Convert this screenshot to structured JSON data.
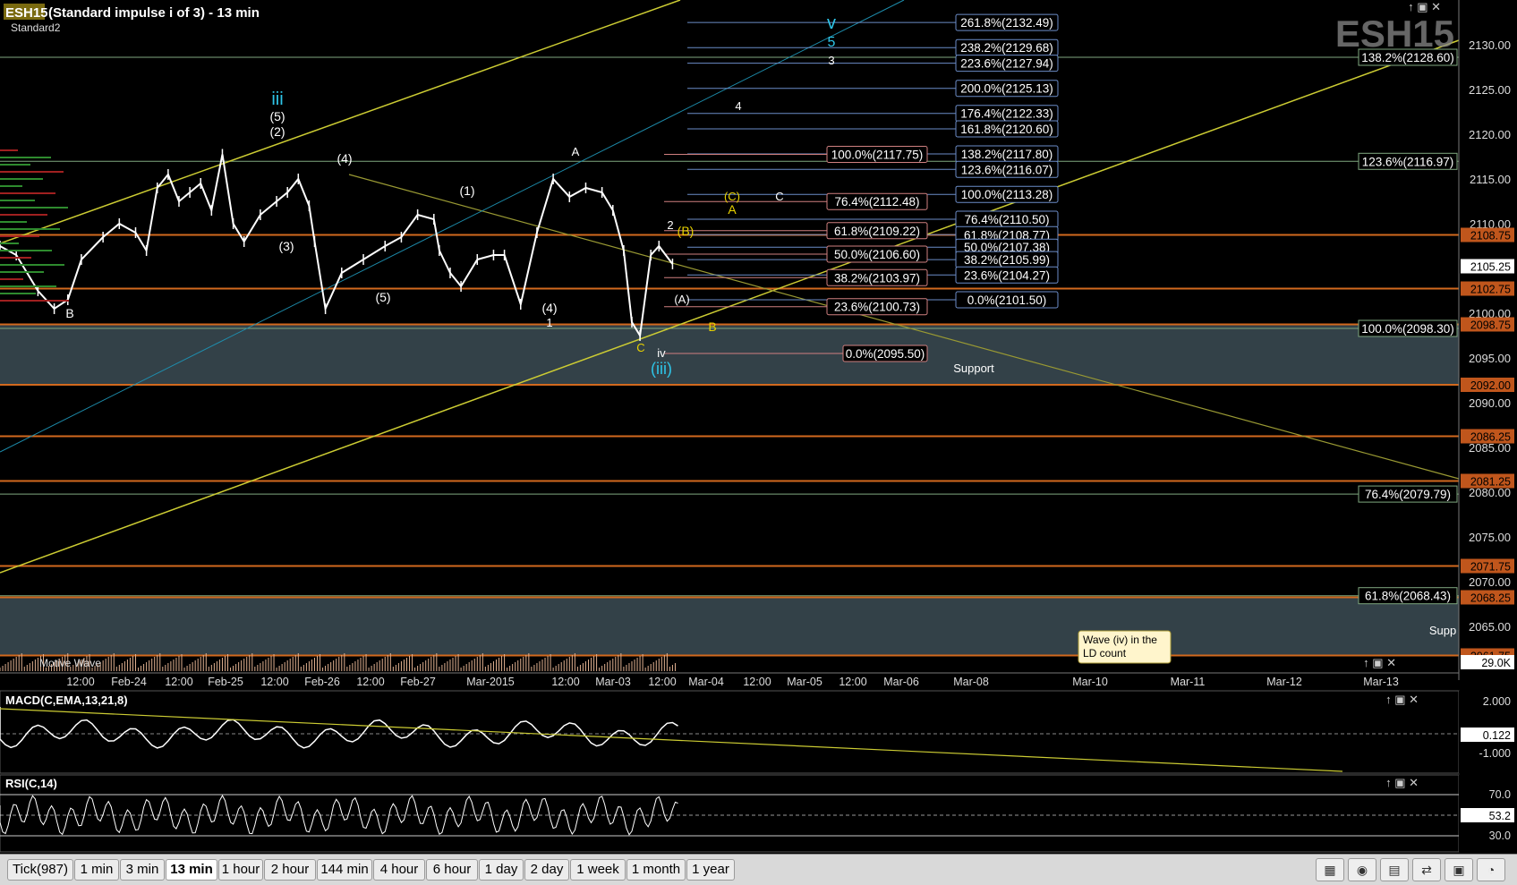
{
  "header": {
    "symbol": "ESH15",
    "title_rest": "(Standard impulse i of 3) - 13 min",
    "template": "Standard2",
    "watermark": "ESH15"
  },
  "chart_data": {
    "type": "candlestick",
    "symbol": "ESH15",
    "interval": "13 min",
    "price_axis": {
      "range": [
        2059,
        2135
      ],
      "ticks": [
        2130,
        2125,
        2120,
        2115,
        2110,
        2105,
        2100,
        2095,
        2090,
        2085,
        2080,
        2075,
        2070,
        2065
      ],
      "labels": [
        "2130.00",
        "2125.00",
        "2120.00",
        "2115.00",
        "2110.00",
        "2105.00",
        "2100.00",
        "2095.00",
        "2090.00",
        "2085.00",
        "2080.00",
        "2075.00",
        "2070.00",
        "2065.00"
      ],
      "current_price": "2105.25",
      "volume_label": "29.0K"
    },
    "x_axis_labels": [
      "12:00",
      "Feb-24",
      "12:00",
      "Feb-25",
      "12:00",
      "Feb-26",
      "12:00",
      "Feb-27",
      "Mar-2015",
      "12:00",
      "Mar-03",
      "12:00",
      "Mar-04",
      "12:00",
      "Mar-05",
      "12:00",
      "Mar-06",
      "Mar-08",
      "Mar-10",
      "Mar-11",
      "Mar-12",
      "Mar-13"
    ],
    "price_path": [
      [
        0,
        2107.5
      ],
      [
        6,
        2106.5
      ],
      [
        14,
        2102.5
      ],
      [
        20,
        2100.5
      ],
      [
        25,
        2101.5
      ],
      [
        30,
        2106
      ],
      [
        38,
        2108.5
      ],
      [
        44,
        2110
      ],
      [
        50,
        2109
      ],
      [
        54,
        2107
      ],
      [
        58,
        2114
      ],
      [
        62,
        2115.5
      ],
      [
        66,
        2112.5
      ],
      [
        70,
        2113.5
      ],
      [
        74,
        2114.5
      ],
      [
        78,
        2111.5
      ],
      [
        82,
        2117.75
      ],
      [
        86,
        2110
      ],
      [
        90,
        2108
      ],
      [
        96,
        2111
      ],
      [
        102,
        2112.5
      ],
      [
        106,
        2113.5
      ],
      [
        110,
        2115
      ],
      [
        114,
        2112
      ],
      [
        116,
        2108
      ],
      [
        120,
        2100.5
      ],
      [
        126,
        2104.5
      ],
      [
        134,
        2106
      ],
      [
        142,
        2107.5
      ],
      [
        148,
        2108.5
      ],
      [
        154,
        2111
      ],
      [
        160,
        2110.5
      ],
      [
        162,
        2107
      ],
      [
        166,
        2104.5
      ],
      [
        170,
        2103
      ],
      [
        176,
        2106
      ],
      [
        182,
        2106.5
      ],
      [
        186,
        2106.5
      ],
      [
        192,
        2101
      ],
      [
        198,
        2109
      ],
      [
        204,
        2115
      ],
      [
        210,
        2113
      ],
      [
        216,
        2114
      ],
      [
        222,
        2113.5
      ],
      [
        226,
        2111.5
      ],
      [
        230,
        2107
      ],
      [
        233,
        2099
      ],
      [
        236,
        2097.5
      ],
      [
        240,
        2106.5
      ],
      [
        243,
        2107.5
      ],
      [
        248,
        2105.5
      ]
    ],
    "horizontal_levels": [
      2108.75,
      2102.75,
      2098.75,
      2092.0,
      2086.25,
      2081.25,
      2071.75,
      2068.25,
      2061.75
    ],
    "right_axis_level_labels": [
      "2108.75",
      "2102.75",
      "2098.75",
      "2092.00",
      "2086.25",
      "2081.25",
      "2071.75",
      "2068.25",
      "2061.75"
    ],
    "support_zones": [
      [
        2092.0,
        2098.75
      ],
      [
        2061.75,
        2068.25
      ]
    ],
    "support_labels": [
      "Support",
      "Supp"
    ],
    "fib_far_right": [
      "138.2%(2128.60)",
      "123.6%(2116.97)",
      "100.0%(2098.30)",
      "76.4%(2079.79)",
      "61.8%(2068.43)"
    ],
    "fib_set_b": [
      "261.8%(2132.49)",
      "238.2%(2129.68)",
      "223.6%(2127.94)",
      "200.0%(2125.13)",
      "176.4%(2122.33)",
      "161.8%(2120.60)",
      "138.2%(2117.80)",
      "123.6%(2116.07)",
      "100.0%(2113.28)",
      "76.4%(2110.50)",
      "61.8%(2108.77)",
      "50.0%(2107.38)",
      "38.2%(2105.99)",
      "23.6%(2104.27)",
      "0.0%(2101.50)"
    ],
    "fib_set_a": [
      "100.0%(2117.75)",
      "76.4%(2112.48)",
      "61.8%(2109.22)",
      "50.0%(2106.60)",
      "38.2%(2103.97)",
      "23.6%(2100.73)",
      "0.0%(2095.50)"
    ],
    "wave_labels": [
      "iii",
      "(5)",
      "(2)",
      "(4)",
      "(1)",
      "(3)",
      "(5)",
      "(4)",
      "B",
      "A",
      "1",
      "2",
      "(A)",
      "(B)",
      "B",
      "(C)",
      "A",
      "C",
      "iv",
      "(iii)",
      "v",
      "5",
      "3",
      "4",
      "C"
    ],
    "note": "Wave (iv) in the LD count",
    "annotation_text": "Motive Wave"
  },
  "macd": {
    "label": "MACD(C,EMA,13,21,8)",
    "axis": [
      "2.000",
      "0.122",
      "-1.000"
    ],
    "current_value": "0.122"
  },
  "rsi": {
    "label": "RSI(C,14)",
    "axis": [
      "70.0",
      "53.2",
      "30.0"
    ],
    "current_value": "53.2"
  },
  "tabs": [
    "Tick(987)",
    "1 min",
    "3 min",
    "13 min",
    "1 hour",
    "2 hour",
    "144 min",
    "4 hour",
    "6 hour",
    "1 day",
    "2 day",
    "1 week",
    "1 month",
    "1 year"
  ],
  "active_tab": "13 min",
  "toolbar_icons": [
    "chart-icon",
    "eye-icon",
    "layers-icon",
    "exchange-icon",
    "calendar-icon",
    "clock-icon"
  ],
  "colors": {
    "up": "#ffffff",
    "orange_level": "#d2691e",
    "fib_label_border": "#6b8cc7",
    "yellow_trend": "#cccc33",
    "cyan_trend": "#1e90b0",
    "wave_cyan": "#2ec5e8",
    "wave_yellow": "#e8d200",
    "zone": "#3c4c55"
  }
}
